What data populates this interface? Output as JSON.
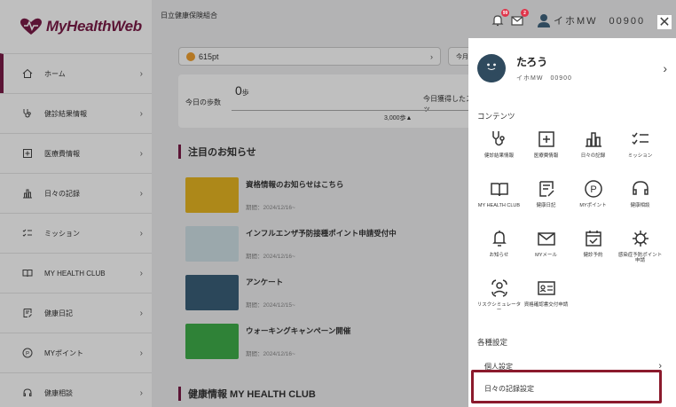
{
  "brand": {
    "logo_text": "MyHealthWeb"
  },
  "sidebar": {
    "items": [
      {
        "label": "ホーム",
        "icon": "home-icon"
      },
      {
        "label": "健診結果情報",
        "icon": "stethoscope-icon"
      },
      {
        "label": "医療費情報",
        "icon": "plus-box-icon"
      },
      {
        "label": "日々の記録",
        "icon": "bar-chart-icon"
      },
      {
        "label": "ミッション",
        "icon": "checklist-icon"
      },
      {
        "label": "MY HEALTH CLUB",
        "icon": "book-icon"
      },
      {
        "label": "健康日記",
        "icon": "diary-icon"
      },
      {
        "label": "MYポイント",
        "icon": "point-icon"
      },
      {
        "label": "健康相談",
        "icon": "headset-icon"
      }
    ]
  },
  "header": {
    "org": "日立健康保険組合",
    "user_id": "イホMW　00900",
    "notify_badge": "99",
    "mail_badge": "2"
  },
  "main": {
    "points": "615pt",
    "rank_label": "今月のランク",
    "steps_label": "今日の歩数",
    "steps_value": "0",
    "steps_unit": "歩",
    "scratch_label": "今日獲得したスクラッ",
    "goal": "3,000歩▲",
    "notice_title": "注目のお知らせ",
    "news": [
      {
        "title": "資格情報のお知らせはこちら",
        "date": "期間：2024/12/16~"
      },
      {
        "title": "インフルエンザ予防接種ポイント申請受付中",
        "date": "期間：2024/12/16~"
      },
      {
        "title": "アンケート",
        "date": "期間：2024/12/15~"
      },
      {
        "title": "ウォーキングキャンペーン開催",
        "date": "期間：2024/12/16~"
      }
    ],
    "club_title": "健康情報 MY HEALTH CLUB"
  },
  "drawer": {
    "profile": {
      "name": "たろう",
      "id": "イホMW　00900"
    },
    "contents_title": "コンテンツ",
    "items": [
      {
        "label": "健診結果情報",
        "icon": "stethoscope-icon"
      },
      {
        "label": "医療費情報",
        "icon": "plus-box-icon"
      },
      {
        "label": "日々の記録",
        "icon": "bar-chart-icon"
      },
      {
        "label": "ミッション",
        "icon": "checklist-icon"
      },
      {
        "label": "MY HEALTH CLUB",
        "icon": "book-icon"
      },
      {
        "label": "健康日記",
        "icon": "diary-icon"
      },
      {
        "label": "MYポイント",
        "icon": "point-icon"
      },
      {
        "label": "健康相談",
        "icon": "headset-icon"
      },
      {
        "label": "お知らせ",
        "icon": "bell-icon"
      },
      {
        "label": "MYメール",
        "icon": "mail-icon"
      },
      {
        "label": "健診予約",
        "icon": "calendar-check-icon"
      },
      {
        "label": "感染症予防ポイント申請",
        "icon": "virus-icon"
      },
      {
        "label": "リスクシミュレーター",
        "icon": "risk-sim-icon"
      },
      {
        "label": "資格確認書交付申請",
        "icon": "id-card-icon"
      }
    ],
    "settings_title": "各種設定",
    "settings": [
      {
        "label": "個人設定"
      },
      {
        "label": "日々の記録設定"
      }
    ]
  },
  "colors": {
    "brand": "#7a1b47",
    "highlight": "#8b1a2c",
    "badge": "#e0344a"
  }
}
